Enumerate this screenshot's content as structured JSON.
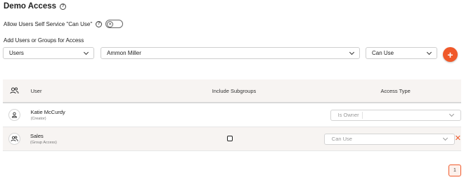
{
  "page": {
    "title": "Demo Access",
    "self_service_label": "Allow Users Self Service \"Can Use\"",
    "self_service_enabled": false,
    "add_label": "Add Users or Groups for Access"
  },
  "filters": {
    "type_value": "Users",
    "user_value": "Ammon Miller",
    "access_value": "Can Use",
    "add_button": "+"
  },
  "table": {
    "headers": {
      "user": "User",
      "include_subgroups": "Include Subgroups",
      "access_type": "Access Type"
    },
    "rows": [
      {
        "name": "Katie McCurdy",
        "sub": "(Creator)",
        "avatar_icon": "user-icon",
        "include_subgroups": null,
        "access": "Is Owner"
      },
      {
        "name": "Sales",
        "sub": "(Group Access)",
        "avatar_icon": "group-icon",
        "include_subgroups": false,
        "access": "Can Use",
        "remove": "✕"
      }
    ]
  },
  "pagination": {
    "current_page": "1"
  },
  "colors": {
    "accent": "#f0592a",
    "header_bg": "#f7f4f2"
  }
}
